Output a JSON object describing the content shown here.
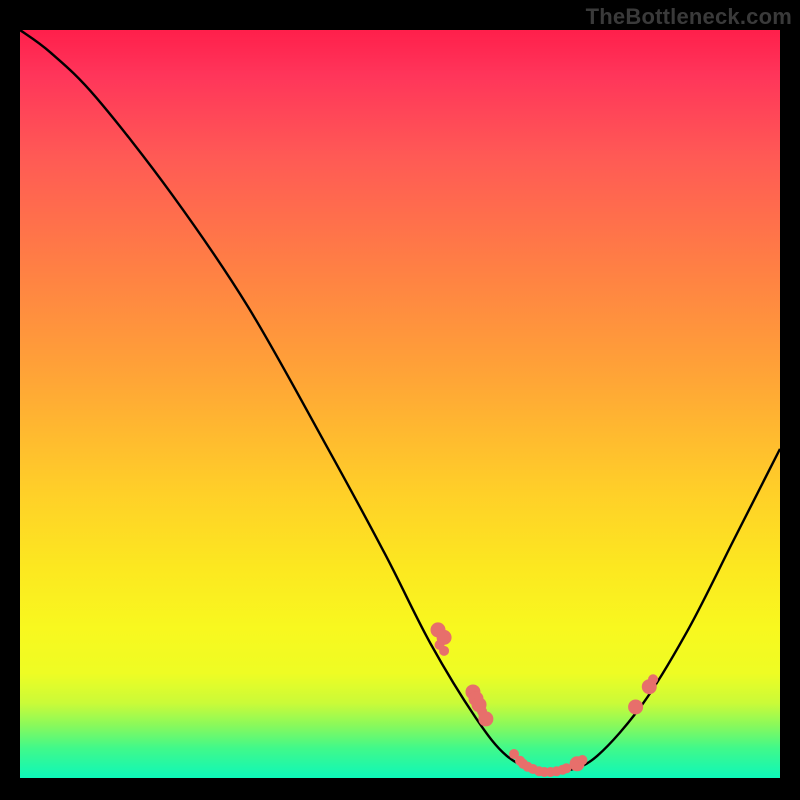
{
  "attribution": "TheBottleneck.com",
  "chart_data": {
    "type": "line",
    "title": "",
    "xlabel": "",
    "ylabel": "",
    "xlim": [
      0,
      100
    ],
    "ylim": [
      0,
      100
    ],
    "curve": [
      {
        "x": 0,
        "y": 100
      },
      {
        "x": 4,
        "y": 97
      },
      {
        "x": 10,
        "y": 91
      },
      {
        "x": 20,
        "y": 78
      },
      {
        "x": 30,
        "y": 63
      },
      {
        "x": 40,
        "y": 45
      },
      {
        "x": 48,
        "y": 30
      },
      {
        "x": 54,
        "y": 18
      },
      {
        "x": 60,
        "y": 8
      },
      {
        "x": 64,
        "y": 3
      },
      {
        "x": 68,
        "y": 1
      },
      {
        "x": 72,
        "y": 1
      },
      {
        "x": 76,
        "y": 3
      },
      {
        "x": 82,
        "y": 10
      },
      {
        "x": 88,
        "y": 20
      },
      {
        "x": 94,
        "y": 32
      },
      {
        "x": 100,
        "y": 44
      }
    ],
    "markers": [
      {
        "x": 55.0,
        "y": 19.8,
        "size": "L"
      },
      {
        "x": 55.4,
        "y": 19.2,
        "size": "S"
      },
      {
        "x": 55.8,
        "y": 17.0,
        "size": "S"
      },
      {
        "x": 55.8,
        "y": 18.8,
        "size": "L"
      },
      {
        "x": 55.2,
        "y": 17.8,
        "size": "S"
      },
      {
        "x": 59.6,
        "y": 11.5,
        "size": "L"
      },
      {
        "x": 60.0,
        "y": 10.6,
        "size": "L"
      },
      {
        "x": 60.4,
        "y": 9.8,
        "size": "L"
      },
      {
        "x": 60.8,
        "y": 8.9,
        "size": "S"
      },
      {
        "x": 61.3,
        "y": 7.9,
        "size": "L"
      },
      {
        "x": 61.0,
        "y": 8.4,
        "size": "S"
      },
      {
        "x": 65.0,
        "y": 3.2,
        "size": "S"
      },
      {
        "x": 65.8,
        "y": 2.3,
        "size": "S"
      },
      {
        "x": 66.2,
        "y": 1.9,
        "size": "S"
      },
      {
        "x": 66.8,
        "y": 1.5,
        "size": "S"
      },
      {
        "x": 67.5,
        "y": 1.2,
        "size": "S"
      },
      {
        "x": 68.3,
        "y": 0.9,
        "size": "S"
      },
      {
        "x": 69.0,
        "y": 0.8,
        "size": "S"
      },
      {
        "x": 69.8,
        "y": 0.8,
        "size": "S"
      },
      {
        "x": 70.6,
        "y": 0.9,
        "size": "S"
      },
      {
        "x": 71.4,
        "y": 1.1,
        "size": "S"
      },
      {
        "x": 71.9,
        "y": 1.3,
        "size": "S"
      },
      {
        "x": 73.3,
        "y": 1.9,
        "size": "L"
      },
      {
        "x": 74.0,
        "y": 2.4,
        "size": "S"
      },
      {
        "x": 81.0,
        "y": 9.5,
        "size": "L"
      },
      {
        "x": 82.8,
        "y": 12.2,
        "size": "L"
      },
      {
        "x": 83.3,
        "y": 13.2,
        "size": "S"
      }
    ],
    "colors": {
      "top": "#ff1f4b",
      "mid": "#ffd028",
      "bottom": "#0df7ba",
      "marker": "#e76f6b",
      "curve": "#000000"
    }
  }
}
